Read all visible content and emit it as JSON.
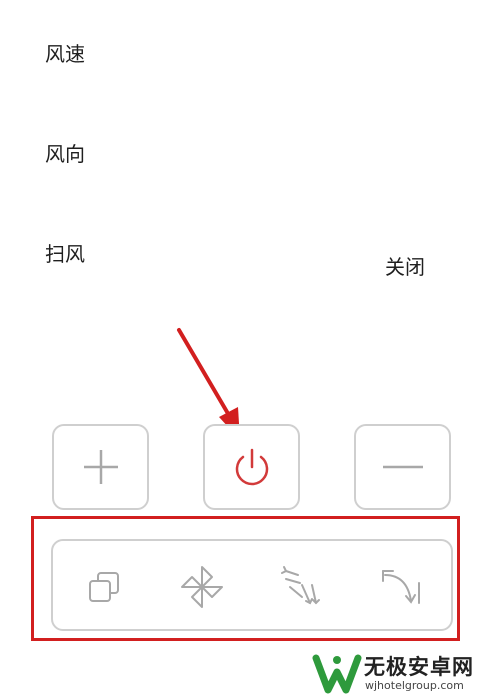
{
  "labels": {
    "wind_speed": "风速",
    "wind_direction": "风向",
    "swing": "扫风",
    "power_status": "关闭"
  },
  "controls": {
    "increase_symbol": "+",
    "decrease_symbol": "—"
  },
  "icons": {
    "increase": "plus-icon",
    "power": "power-icon",
    "decrease": "minus-icon",
    "mode_1": "layers-icon",
    "mode_2": "fan-icon",
    "mode_3": "swing-arrows-icon",
    "mode_4": "curved-arrow-icon"
  },
  "colors": {
    "power_accent": "#d23a3a",
    "annotation_red": "#d21f1f",
    "border_gray": "#cfcfcf",
    "icon_gray": "#a8a8a8",
    "watermark_green": "#2e9a3c"
  },
  "watermark": {
    "title": "无极安卓网",
    "url": "wjhotelgroup.com"
  }
}
